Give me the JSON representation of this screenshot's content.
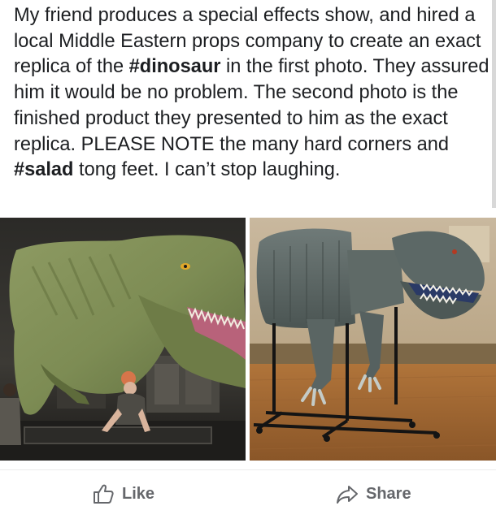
{
  "post": {
    "text_before_tag1": "My friend produces a special effects show, and hired a local Middle Eastern props company to create an exact replica of the ",
    "tag1": "#dinosaur",
    "text_between_tags": " in the first photo. They assured him it would be no problem. The second photo is the finished product they presented to him as the exact replica.  PLEASE NOTE the many hard corners and ",
    "tag2": "#salad",
    "text_after_tag2": " tong feet. I can’t stop laughing."
  },
  "photos": [
    {
      "subject": "original-dinosaur-puppet"
    },
    {
      "subject": "replica-dinosaur-prop"
    }
  ],
  "actions": {
    "like_label": "Like",
    "share_label": "Share",
    "like_icon": "thumbs-up-icon",
    "share_icon": "share-arrow-icon"
  },
  "colors": {
    "text": "#1c1e21",
    "action_text": "#65676b"
  }
}
